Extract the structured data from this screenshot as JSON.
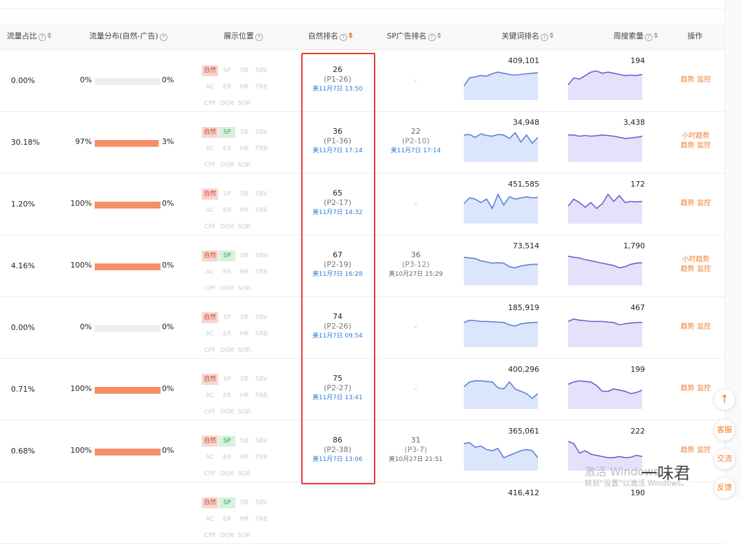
{
  "headers": {
    "traffic_share": "流量占比",
    "traffic_dist": "流量分布(自然-广告)",
    "display_pos": "展示位置",
    "natural_rank": "自然排名",
    "sp_rank": "SP广告排名",
    "keyword_rank": "关键词排名",
    "weekly_search": "周搜索量",
    "actions": "操作"
  },
  "tag_labels": [
    [
      "自然",
      "SP",
      "SB",
      "SBV"
    ],
    [
      "AC",
      "ER",
      "HR",
      "TRB"
    ],
    [
      "CPF",
      "OOR",
      "SOR"
    ]
  ],
  "rows": [
    {
      "share": "0.00%",
      "left": "0%",
      "right": "0%",
      "fill": 0,
      "nat_active": true,
      "sp_active": false,
      "nat_rank": "26",
      "nat_page": "(P1-26)",
      "nat_time": "美11月7日 13:50",
      "sp_rank": "",
      "sp_page": "",
      "sp_time": "",
      "sp_dash": "-",
      "kw": "409,101",
      "sw": "194",
      "actions": [
        "趋势",
        "监控"
      ]
    },
    {
      "share": "30.18%",
      "left": "97%",
      "right": "3%",
      "fill": 97,
      "nat_active": true,
      "sp_active": true,
      "nat_rank": "36",
      "nat_page": "(P1-36)",
      "nat_time": "美11月7日 17:14",
      "sp_rank": "22",
      "sp_page": "(P2-10)",
      "sp_time": "美11月7日 17:14",
      "sp_dash": "",
      "kw": "34,948",
      "sw": "3,438",
      "actions": [
        "小时趋势",
        "趋势",
        "监控"
      ]
    },
    {
      "share": "1.20%",
      "left": "100%",
      "right": "0%",
      "fill": 100,
      "nat_active": true,
      "sp_active": false,
      "nat_rank": "65",
      "nat_page": "(P2-17)",
      "nat_time": "美11月7日 14:32",
      "sp_rank": "",
      "sp_page": "",
      "sp_time": "",
      "sp_dash": "-",
      "kw": "451,585",
      "sw": "172",
      "actions": [
        "趋势",
        "监控"
      ]
    },
    {
      "share": "4.16%",
      "left": "100%",
      "right": "0%",
      "fill": 100,
      "nat_active": true,
      "sp_active": true,
      "nat_rank": "67",
      "nat_page": "(P2-19)",
      "nat_time": "美11月7日 16:28",
      "sp_rank": "36",
      "sp_page": "(P3-12)",
      "sp_time": "美10月27日 15:29",
      "sp_dash": "",
      "kw": "73,514",
      "sw": "1,790",
      "actions": [
        "小时趋势",
        "趋势",
        "监控"
      ]
    },
    {
      "share": "0.00%",
      "left": "0%",
      "right": "0%",
      "fill": 0,
      "nat_active": true,
      "sp_active": false,
      "nat_rank": "74",
      "nat_page": "(P2-26)",
      "nat_time": "美11月7日 09:54",
      "sp_rank": "",
      "sp_page": "",
      "sp_time": "",
      "sp_dash": "-",
      "kw": "185,919",
      "sw": "467",
      "actions": [
        "趋势",
        "监控"
      ]
    },
    {
      "share": "0.71%",
      "left": "100%",
      "right": "0%",
      "fill": 100,
      "nat_active": true,
      "sp_active": false,
      "nat_rank": "75",
      "nat_page": "(P2-27)",
      "nat_time": "美11月7日 13:41",
      "sp_rank": "",
      "sp_page": "",
      "sp_time": "",
      "sp_dash": "-",
      "kw": "400,296",
      "sw": "199",
      "actions": [
        "趋势",
        "监控"
      ]
    },
    {
      "share": "0.68%",
      "left": "100%",
      "right": "0%",
      "fill": 100,
      "nat_active": true,
      "sp_active": true,
      "nat_rank": "86",
      "nat_page": "(P2-38)",
      "nat_time": "美11月7日 13:06",
      "sp_rank": "31",
      "sp_page": "(P3-7)",
      "sp_time": "美10月27日 21:51",
      "sp_dash": "",
      "kw": "365,061",
      "sw": "222",
      "actions": [
        "趋势",
        "监控"
      ]
    },
    {
      "share": "",
      "left": "",
      "right": "",
      "fill": 0,
      "nat_active": true,
      "sp_active": true,
      "nat_rank": "",
      "nat_page": "",
      "nat_time": "",
      "sp_rank": "",
      "sp_page": "",
      "sp_time": "",
      "sp_dash": "",
      "kw": "416,412",
      "sw": "190",
      "actions": []
    }
  ],
  "floating": {
    "up": "↑",
    "service": "客服",
    "exchange": "交流",
    "feedback": "反馈"
  },
  "watermark": {
    "line1": "激活 Windows",
    "line2": "转到“设置”以激活 Windows。",
    "brand": "一味君"
  },
  "colors": {
    "accent": "#f07a2b",
    "link": "#2d7fd6",
    "bar": "#f59066",
    "redbox": "#e53935"
  }
}
